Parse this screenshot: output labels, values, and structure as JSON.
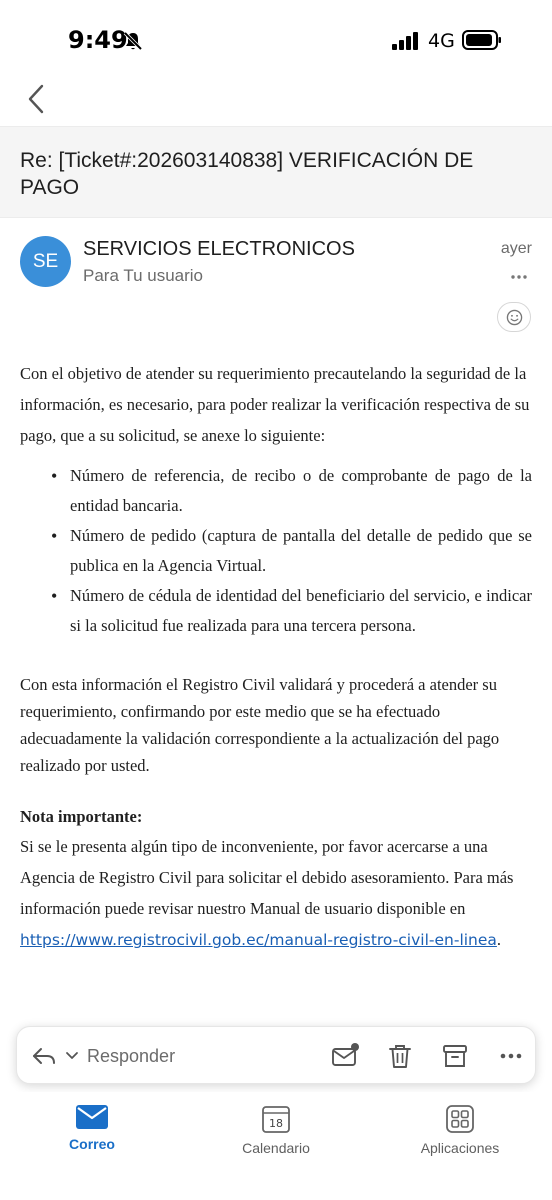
{
  "status": {
    "time": "9:49",
    "network": "4G"
  },
  "email": {
    "subject": "Re: [Ticket#:202603140838] VERIFICACIÓN DE PAGO",
    "sender_initials": "SE",
    "sender_name": "SERVICIOS ELECTRONICOS",
    "recipient_line": "Para Tu usuario",
    "date": "ayer",
    "body": {
      "intro": "Con el objetivo de atender su requerimiento precautelando la seguridad de la información, es necesario, para poder realizar la verificación respectiva de su pago, que a su solicitud, se anexe lo siguiente:",
      "bullets": [
        "Número de referencia, de recibo o de comprobante de pago de la entidad bancaria.",
        "Número de pedido (captura de pantalla del detalle de pedido que se publica en la Agencia Virtual.",
        "Número de cédula de identidad del beneficiario del servicio, e indicar si la solicitud fue realizada para una tercera persona."
      ],
      "paragraph2": "Con esta información el Registro Civil validará y procederá a atender su requerimiento, confirmando por este medio que se ha efectuado adecuadamente la validación correspondiente a la actualización del pago realizado por usted.",
      "note_title": "Nota importante:",
      "note_text": "Si se le presenta algún tipo de inconveniente, por favor acercarse a una Agencia de Registro Civil para solicitar el debido asesoramiento. Para más información puede revisar nuestro Manual de usuario disponible en ",
      "link": "https://www.registrocivil.gob.ec/manual-registro-civil-en-linea",
      "link_suffix": "."
    }
  },
  "actions": {
    "reply_label": "Responder",
    "icons": [
      "reply-icon",
      "chevron-down-icon",
      "mark-unread-icon",
      "trash-icon",
      "archive-icon",
      "more-icon"
    ]
  },
  "tabs": [
    {
      "label": "Correo",
      "icon": "mail-icon",
      "active": true
    },
    {
      "label": "Calendario",
      "icon": "calendar-icon",
      "day": "18",
      "active": false
    },
    {
      "label": "Aplicaciones",
      "icon": "apps-icon",
      "active": false
    }
  ],
  "colors": {
    "accent": "#1a6fc8",
    "avatar": "#3a8fd9",
    "link": "#1a5fb4"
  }
}
